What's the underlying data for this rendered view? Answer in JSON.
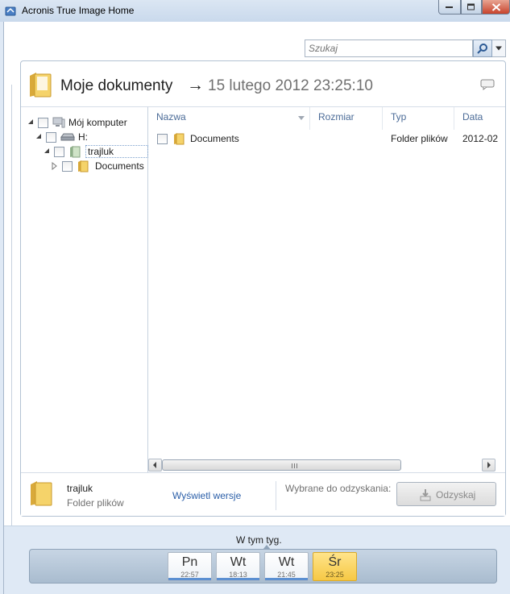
{
  "window": {
    "title": "Acronis True Image Home"
  },
  "search": {
    "placeholder": "Szukaj"
  },
  "header": {
    "title": "Moje dokumenty",
    "arrow": "→",
    "date": "15 lutego 2012 23:25:10"
  },
  "tree": {
    "items": [
      {
        "label": "Mój komputer",
        "icon": "computer-icon",
        "expanded": true
      },
      {
        "label": "H:",
        "icon": "drive-icon",
        "expanded": true
      },
      {
        "label": "trajluk",
        "icon": "user-folder-icon",
        "expanded": true,
        "selected": true
      },
      {
        "label": "Documents",
        "icon": "folder-icon",
        "expanded": false
      }
    ]
  },
  "list": {
    "columns": [
      "Nazwa",
      "Rozmiar",
      "Typ",
      "Data"
    ],
    "rows": [
      {
        "name": "Documents",
        "size": "",
        "type": "Folder plików",
        "date": "2012-02"
      }
    ]
  },
  "status": {
    "selected_name": "trajluk",
    "selected_type": "Folder plików",
    "versions_link": "Wyświetl wersje",
    "recover_caption": "Wybrane do odzyskania:",
    "recover_button": "Odzyskaj"
  },
  "timeline": {
    "label": "W tym tyg.",
    "days": [
      {
        "day": "Pn",
        "time": "22:57",
        "active": false
      },
      {
        "day": "Wt",
        "time": "18:13",
        "active": false
      },
      {
        "day": "Wt",
        "time": "21:45",
        "active": false
      },
      {
        "day": "Śr",
        "time": "23:25",
        "active": true
      }
    ]
  },
  "colors": {
    "accent": "#2a5ea8",
    "header_text": "#4c6c98",
    "active_day": "#f6c845",
    "folder": "#f0c54a"
  }
}
